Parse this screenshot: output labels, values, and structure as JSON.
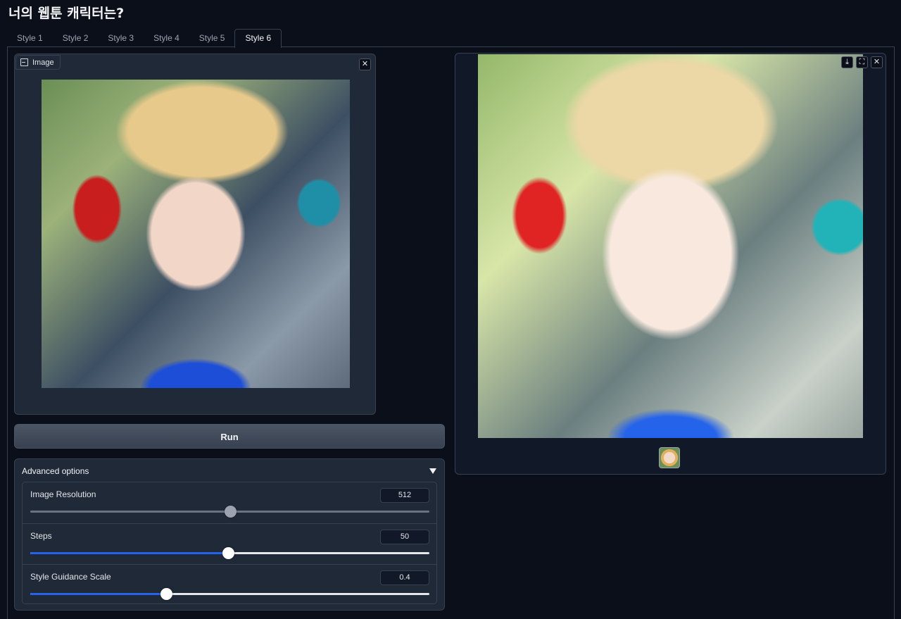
{
  "page_title": "너의 웹툰 캐릭터는?",
  "tabs": [
    "Style 1",
    "Style 2",
    "Style 3",
    "Style 4",
    "Style 5",
    "Style 6"
  ],
  "active_tab": 5,
  "input": {
    "label": "Image"
  },
  "run_label": "Run",
  "advanced": {
    "title": "Advanced options",
    "sliders": [
      {
        "label": "Image Resolution",
        "value": "512",
        "fraction": 0.5,
        "style": "gray"
      },
      {
        "label": "Steps",
        "value": "50",
        "fraction": 0.495,
        "style": "blue"
      },
      {
        "label": "Style Guidance Scale",
        "value": "0.4",
        "fraction": 0.34,
        "style": "blue"
      }
    ]
  },
  "icons": {
    "image_label": "image-icon",
    "clear": "close-icon",
    "download": "download-icon",
    "fullscreen": "fullscreen-icon",
    "caret": "triangle-down-icon"
  },
  "colors": {
    "background": "#0b0f19",
    "panel": "#1f2937",
    "accent": "#2563eb"
  }
}
